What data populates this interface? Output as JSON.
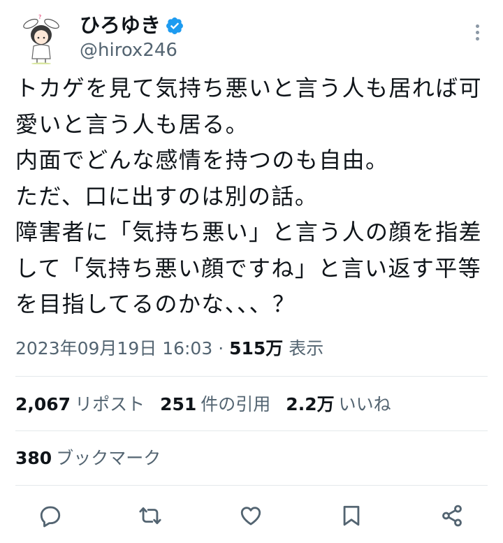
{
  "author": {
    "display_name": "ひろゆき",
    "handle": "@hirox246",
    "verified": true,
    "verified_color": "#1d9bf0",
    "avatar": "rabbit-eared-girl-avatar"
  },
  "tweet": {
    "text_lines": [
      "トカゲを見て気持ち悪いと言う人も居れば可",
      "愛いと言う人も居る。",
      "内面でどんな感情を持つのも自由。",
      "ただ、口に出すのは別の話。",
      "障害者に「気持ち悪い」と言う人の顔を指差",
      "して「気持ち悪い顔ですね」と言い返す平等",
      "を目指してるのかな、、、？"
    ],
    "timestamp": "2023年09月19日 16:03",
    "separator": " · ",
    "views_count": "515万",
    "views_label": "表示"
  },
  "stats": {
    "reposts_count": "2,067",
    "reposts_label": "リポスト",
    "quotes_count": "251",
    "quotes_label": "件の引用",
    "likes_count": "2.2万",
    "likes_label": "いいね",
    "bookmarks_count": "380",
    "bookmarks_label": "ブックマーク"
  },
  "actions": [
    "reply-icon",
    "repost-icon",
    "like-icon",
    "bookmark-icon",
    "share-icon"
  ],
  "colors": {
    "text": "#0f1419",
    "secondary": "#536471",
    "divider": "#e4e8eb"
  }
}
